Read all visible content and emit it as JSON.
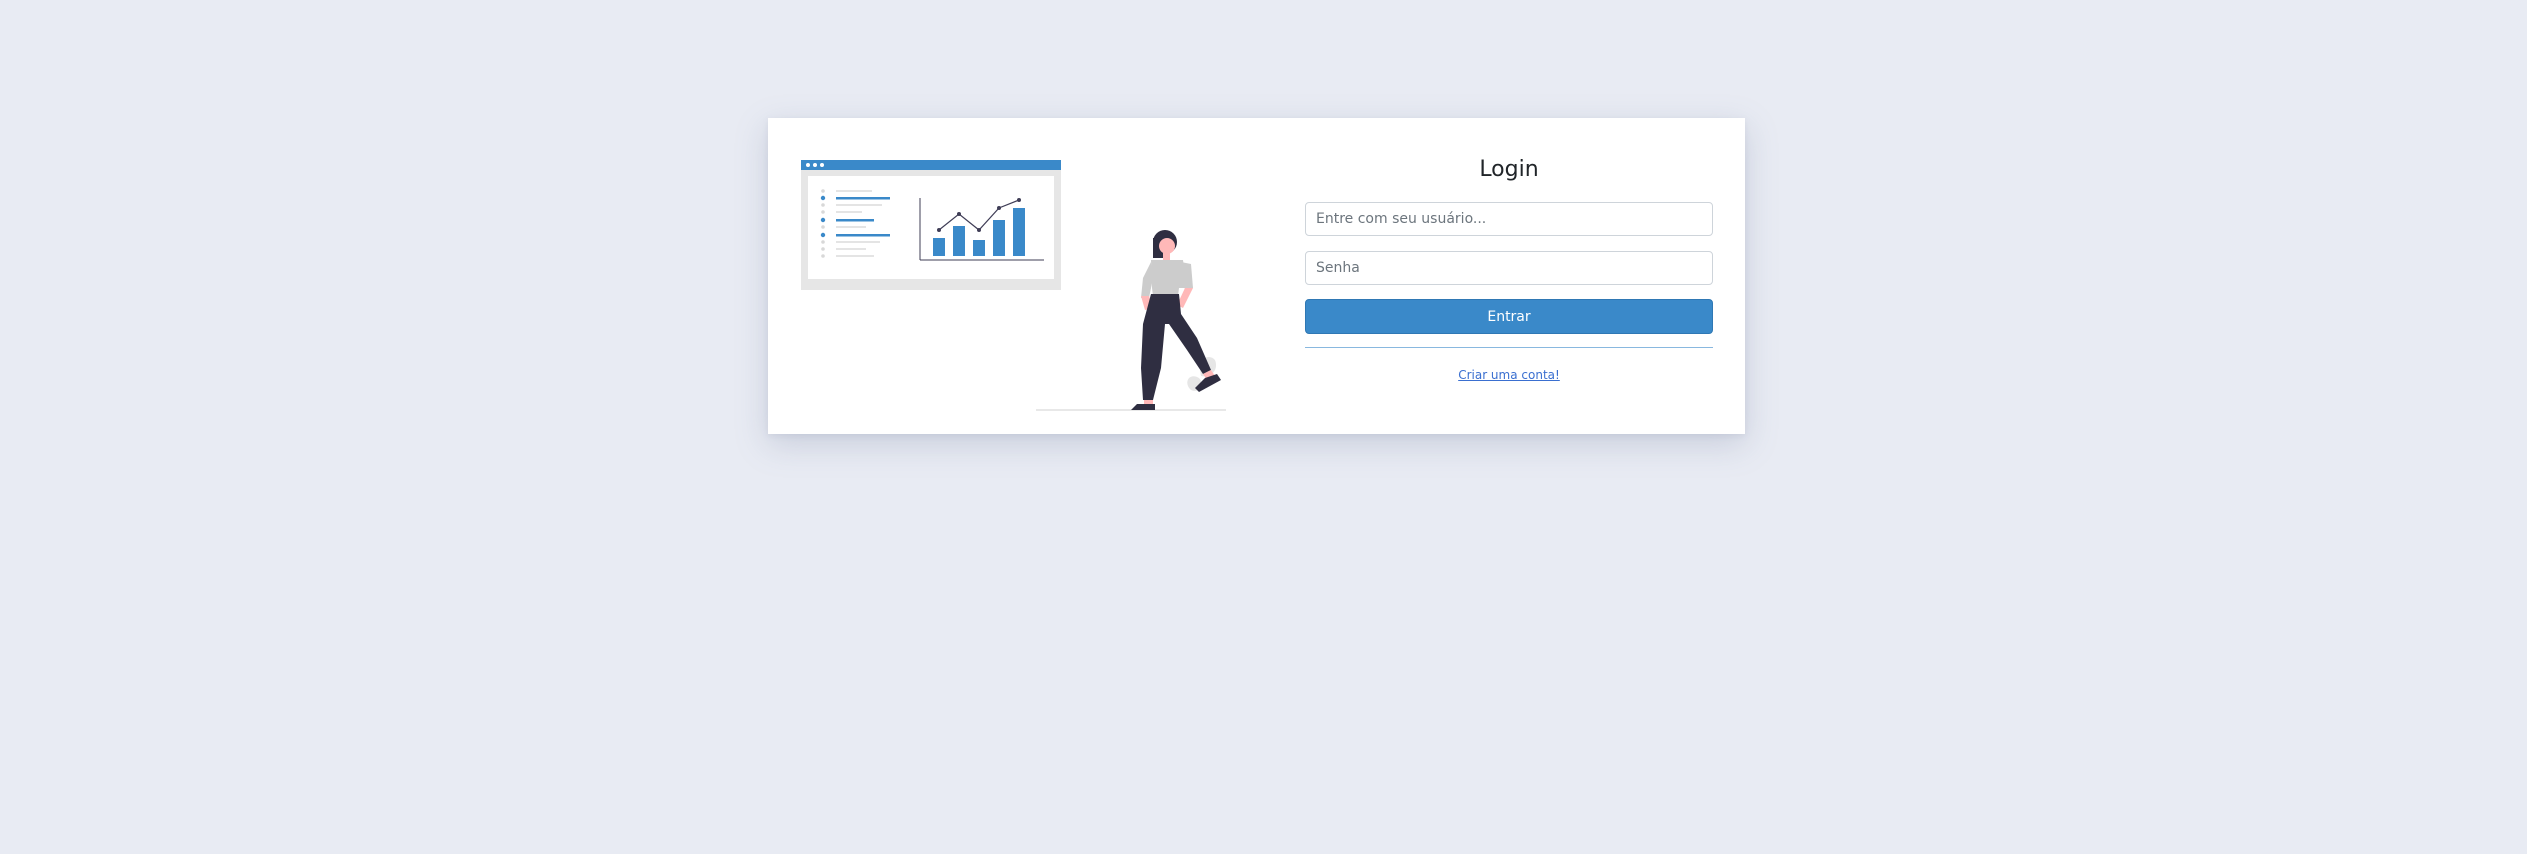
{
  "login": {
    "title": "Login",
    "username_placeholder": "Entre com seu usuário...",
    "username_value": "",
    "password_placeholder": "Senha",
    "password_value": "",
    "submit_label": "Entrar",
    "signup_link": "Criar uma conta!"
  },
  "colors": {
    "background": "#e8ebf3",
    "accent": "#3a89c9",
    "link": "#3a6fd0",
    "card": "#ffffff"
  },
  "illustration": {
    "name": "person-presenting-chart-illustration"
  }
}
